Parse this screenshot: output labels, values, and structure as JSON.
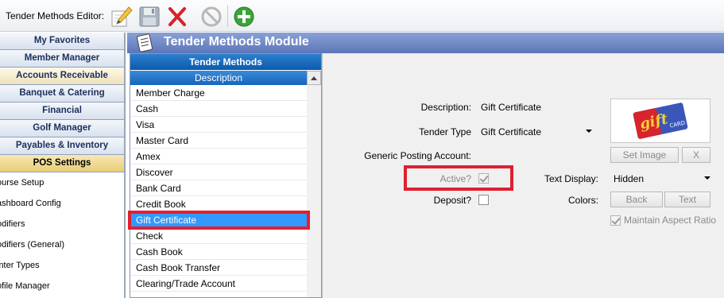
{
  "toolbar": {
    "title": "Tender Methods Editor:",
    "buttons": [
      {
        "name": "edit-button",
        "icon": "pencil-icon"
      },
      {
        "name": "save-button",
        "icon": "floppy-disk-icon"
      },
      {
        "name": "delete-button",
        "icon": "red-x-icon"
      },
      {
        "name": "cancel-button",
        "icon": "no-entry-icon"
      },
      {
        "name": "add-button",
        "icon": "green-plus-icon"
      }
    ]
  },
  "leftnav": {
    "headers": [
      "My Favorites",
      "Member Manager",
      "Accounts Receivable",
      "Banquet & Catering",
      "Financial",
      "Golf Manager",
      "Payables & Inventory",
      "POS Settings"
    ],
    "items": [
      "ourse Setup",
      "ashboard Config",
      "odifiers",
      "odifiers (General)",
      "inter Types",
      "ofile Manager"
    ]
  },
  "module": {
    "title": "Tender Methods Module"
  },
  "list": {
    "title": "Tender Methods",
    "column": "Description",
    "rows": [
      "Member Charge",
      "Cash",
      "Visa",
      "Master Card",
      "Amex",
      "Discover",
      "Bank Card",
      "Credit Book",
      "Gift Certificate",
      "Check",
      "Cash Book",
      "Cash Book Transfer",
      "Clearing/Trade Account"
    ],
    "selected": "Gift Certificate"
  },
  "form": {
    "description_label": "Description:",
    "description_value": "Gift Certificate",
    "tender_type_label": "Tender Type",
    "tender_type_value": "Gift Certificate",
    "posting_label": "Generic Posting Account:",
    "active_label": "Active?",
    "active_checked": true,
    "deposit_label": "Deposit?",
    "deposit_checked": false,
    "text_display_label": "Text Display:",
    "text_display_value": "Hidden",
    "colors_label": "Colors:",
    "set_image_label": "Set Image",
    "clear_image_label": "X",
    "back_label": "Back",
    "text_label": "Text",
    "maintain_aspect_label": "Maintain Aspect Ratio",
    "maintain_aspect_checked": true,
    "image_text": "gift",
    "image_subtext": "CARD"
  },
  "colors": {
    "highlight": "#e02030",
    "selection": "#3399ff",
    "list_header": "#0c5aad",
    "module_header": "#5c76b8"
  }
}
